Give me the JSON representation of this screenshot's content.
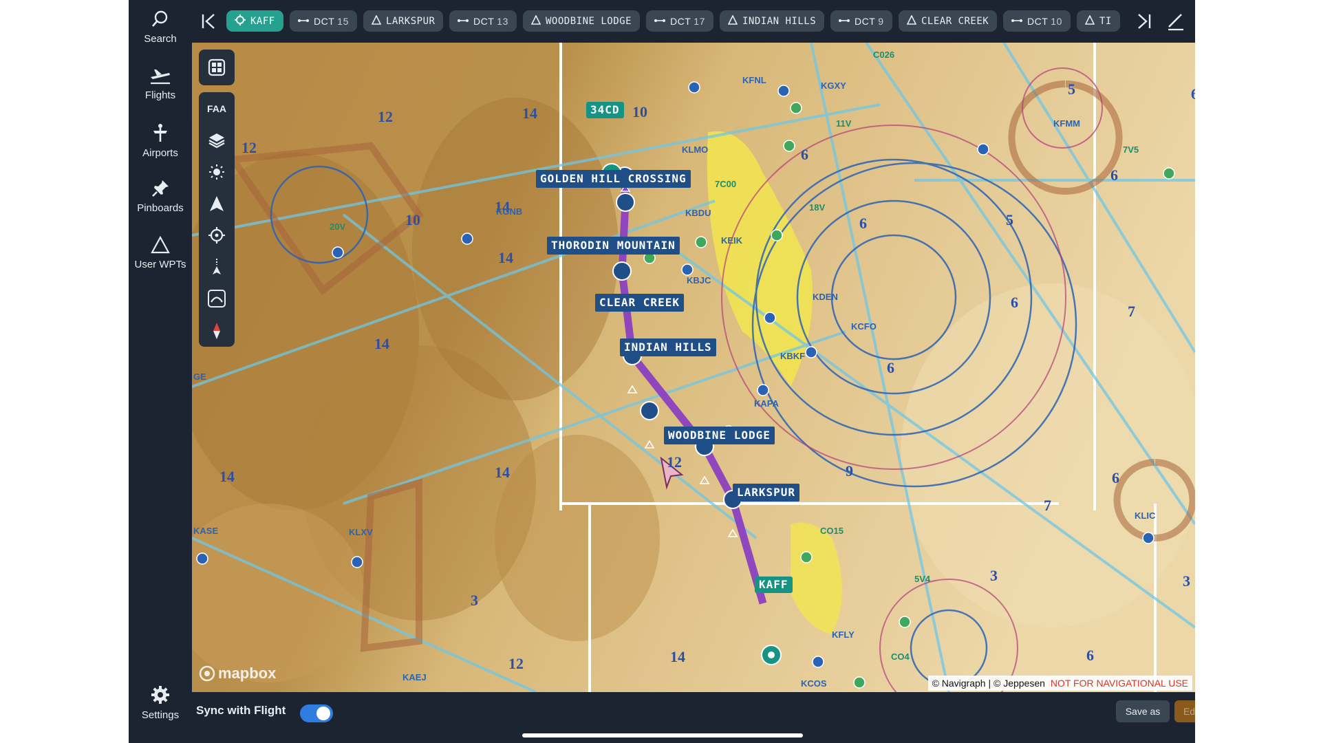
{
  "nav": {
    "search": "Search",
    "flights": "Flights",
    "airports": "Airports",
    "pinboards": "Pinboards",
    "user_wpts": "User WPTs",
    "settings": "Settings"
  },
  "route_pills": [
    {
      "kind": "airport",
      "label": "KAFF"
    },
    {
      "kind": "dct",
      "prefix": "DCT",
      "num": "15"
    },
    {
      "kind": "wpt",
      "label": "LARKSPUR"
    },
    {
      "kind": "dct",
      "prefix": "DCT",
      "num": "13"
    },
    {
      "kind": "wpt",
      "label": "WOODBINE LODGE"
    },
    {
      "kind": "dct",
      "prefix": "DCT",
      "num": "17"
    },
    {
      "kind": "wpt",
      "label": "INDIAN HILLS"
    },
    {
      "kind": "dct",
      "prefix": "DCT",
      "num": "9"
    },
    {
      "kind": "wpt",
      "label": "CLEAR CREEK"
    },
    {
      "kind": "dct",
      "prefix": "DCT",
      "num": "10"
    },
    {
      "kind": "wpt",
      "label": "TI"
    }
  ],
  "map_tools": {
    "faa": "FAA"
  },
  "waypoints": {
    "w34cd": "34CD",
    "golden": "GOLDEN HILL CROSSING",
    "thorodin": "THORODIN MOUNTAIN",
    "clear": "CLEAR CREEK",
    "indian": "INDIAN HILLS",
    "woodbine": "WOODBINE LODGE",
    "larkspur": "LARKSPUR",
    "kaff": "KAFF"
  },
  "chart_labels": {
    "kfnl": "KFNL",
    "kgxy": "KGXY",
    "c026": "C026",
    "v11": "11V",
    "kfmm": "KFMM",
    "v7v5": "7V5",
    "klmo": "KLMO",
    "c00": "7C00",
    "kbdu": "KBDU",
    "v18": "18V",
    "kgnb": "KGNB",
    "v20": "20V",
    "keik": "KEIK",
    "kbjc": "KBJC",
    "kden": "KDEN",
    "kcfo": "KCFO",
    "kbkf": "KBKF",
    "kapa": "KAPA",
    "kase": "KASE",
    "klxv": "KLXV",
    "co15": "CO15",
    "v5v4": "5V4",
    "klic": "KLIC",
    "kfly": "KFLY",
    "co4": "CO4",
    "kcos": "KCOS",
    "kaej": "KAEJ",
    "ge": "GE"
  },
  "altitudes": [
    "12",
    "14",
    "10",
    "5",
    "6",
    "12",
    "14",
    "10",
    "6",
    "5",
    "6",
    "6",
    "7",
    "14",
    "6",
    "6",
    "14",
    "14",
    "12",
    "14",
    "9",
    "7",
    "6",
    "14",
    "12",
    "14",
    "6",
    "3",
    "3",
    "3"
  ],
  "map_brand": "mapbox",
  "attribution": {
    "main": "© Navigraph | © Jeppesen",
    "warning": "NOT FOR NAVIGATIONAL USE"
  },
  "bottom": {
    "sync_label": "Sync with Flight",
    "sync_on": true,
    "save_as": "Save as",
    "edit": "Edit"
  },
  "colors": {
    "panel": "#1b2430",
    "pill": "#3b4654",
    "accent": "#25a28f",
    "route": "#8b3fc0",
    "wpt_label": "#1f4f86",
    "edit": "#8a5a1c",
    "toggle": "#2f7de1"
  }
}
